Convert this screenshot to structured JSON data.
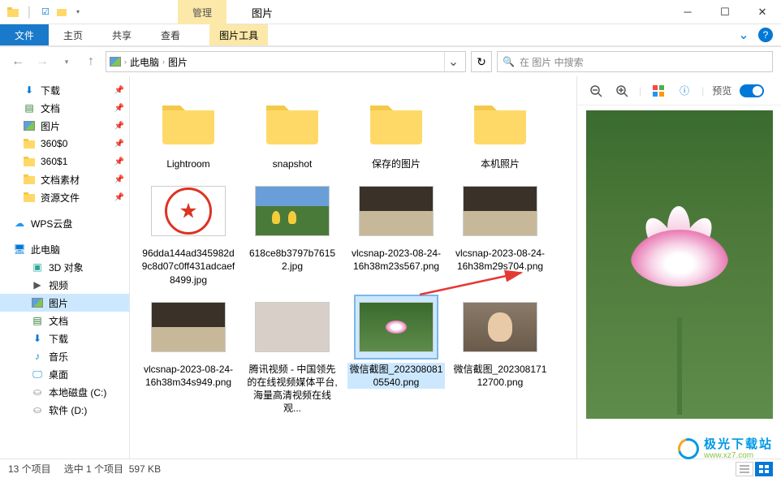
{
  "window": {
    "title": "图片",
    "manage_label": "管理",
    "tools_label": "图片工具"
  },
  "ribbon": {
    "file": "文件",
    "home": "主页",
    "share": "共享",
    "view": "查看",
    "pictools": "图片工具"
  },
  "address": {
    "pc": "此电脑",
    "current": "图片"
  },
  "search": {
    "placeholder": "在 图片 中搜索"
  },
  "sidebar": {
    "quick": [
      {
        "label": "下载",
        "icon": "download",
        "pin": true
      },
      {
        "label": "文档",
        "icon": "doc",
        "pin": true
      },
      {
        "label": "图片",
        "icon": "pic",
        "pin": true
      },
      {
        "label": "360$0",
        "icon": "folder",
        "pin": true
      },
      {
        "label": "360$1",
        "icon": "folder",
        "pin": true
      },
      {
        "label": "文档素材",
        "icon": "folder",
        "pin": true
      },
      {
        "label": "资源文件",
        "icon": "folder",
        "pin": true
      }
    ],
    "wps": "WPS云盘",
    "thispc": "此电脑",
    "pcitems": [
      {
        "label": "3D 对象",
        "icon": "3d"
      },
      {
        "label": "视频",
        "icon": "video"
      },
      {
        "label": "图片",
        "icon": "pic",
        "active": true
      },
      {
        "label": "文档",
        "icon": "doc"
      },
      {
        "label": "下载",
        "icon": "download"
      },
      {
        "label": "音乐",
        "icon": "music"
      },
      {
        "label": "桌面",
        "icon": "desktop"
      },
      {
        "label": "本地磁盘 (C:)",
        "icon": "drive"
      },
      {
        "label": "软件 (D:)",
        "icon": "drive"
      }
    ]
  },
  "files": [
    {
      "name": "Lightroom",
      "type": "folder"
    },
    {
      "name": "snapshot",
      "type": "folder"
    },
    {
      "name": "保存的图片",
      "type": "folder"
    },
    {
      "name": "本机照片",
      "type": "folder"
    },
    {
      "name": "96dda144ad345982d9c8d07c0ff431adcaef8499.jpg",
      "type": "img",
      "thumb": "seal"
    },
    {
      "name": "618ce8b3797b76152.jpg",
      "type": "img",
      "thumb": "tulips"
    },
    {
      "name": "vlcsnap-2023-08-24-16h38m23s567.png",
      "type": "img",
      "thumb": "room"
    },
    {
      "name": "vlcsnap-2023-08-24-16h38m29s704.png",
      "type": "img",
      "thumb": "room"
    },
    {
      "name": "vlcsnap-2023-08-24-16h38m34s949.png",
      "type": "img",
      "thumb": "room"
    },
    {
      "name": "腾讯视频 - 中国领先的在线视频媒体平台,海量高清视频在线观...",
      "type": "img",
      "thumb": "trio"
    },
    {
      "name": "微信截图_20230808105540.png",
      "type": "img",
      "thumb": "lotus",
      "selected": true
    },
    {
      "name": "微信截图_20230817112700.png",
      "type": "img",
      "thumb": "woman"
    }
  ],
  "preview": {
    "label": "预览"
  },
  "status": {
    "count": "13 个项目",
    "selection": "选中 1 个项目",
    "size": "597 KB"
  },
  "watermark": {
    "cn": "极光下载站",
    "en": "www.xz7.com"
  }
}
